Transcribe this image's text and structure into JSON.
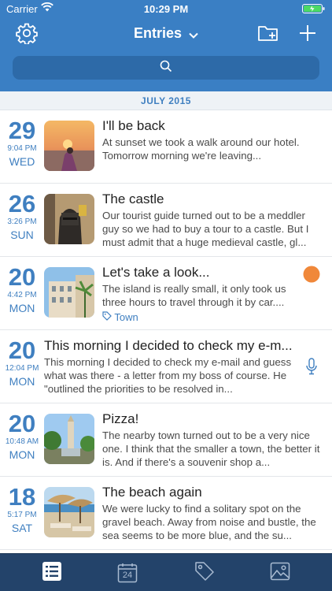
{
  "status": {
    "carrier": "Carrier",
    "time": "10:29 PM"
  },
  "nav": {
    "title": "Entries",
    "icons": [
      "gear-icon",
      "chevron-down-icon",
      "new-folder-icon",
      "plus-icon"
    ]
  },
  "search": {
    "icon": "search-icon"
  },
  "section": {
    "label": "JULY 2015"
  },
  "entries": [
    {
      "day": "29",
      "time": "9:04 PM",
      "weekday": "WED",
      "title": "I'll be back",
      "body": "At sunset we took a walk around our hotel. Tomorrow morning we're leaving...",
      "has_photo": true
    },
    {
      "day": "26",
      "time": "3:26 PM",
      "weekday": "SUN",
      "title": "The castle",
      "body": "Our tourist guide turned out to be a meddler guy so we had to buy a tour to a castle. But I must admit that a huge medieval castle, gl...",
      "has_photo": true
    },
    {
      "day": "20",
      "time": "4:42 PM",
      "weekday": "MON",
      "title": "Let's take a look...",
      "body": "The island is really small, it only took us three hours to travel through it by car....",
      "tag": "Town",
      "has_photo": true,
      "indicator_color": "#f0883a"
    },
    {
      "day": "20",
      "time": "12:04 PM",
      "weekday": "MON",
      "title": "This morning I decided to check my e-m...",
      "body": "This morning I decided to check my e-mail and guess what was there - a letter from my boss of course. He \"outlined the priorities to be resolved in...",
      "has_photo": false,
      "icon": "microphone-icon"
    },
    {
      "day": "20",
      "time": "10:48 AM",
      "weekday": "MON",
      "title": "Pizza!",
      "body": "The nearby town turned out to be a very nice one. I think that the smaller a town, the better it is. And if there's a souvenir shop a...",
      "has_photo": true
    },
    {
      "day": "18",
      "time": "5:17 PM",
      "weekday": "SAT",
      "title": "The beach again",
      "body": "We were lucky to find a solitary spot on the gravel beach. Away from noise and bustle, the sea seems to be more blue, and the su...",
      "has_photo": true
    }
  ],
  "tabbar": {
    "icons": [
      "list-icon",
      "calendar-icon",
      "tag-icon",
      "photo-icon"
    ],
    "calendar_day": "24"
  },
  "colors": {
    "header": "#3a7fc4",
    "accent": "#3f7fc0",
    "tabbar": "#23436a",
    "indicator": "#f0883a"
  }
}
